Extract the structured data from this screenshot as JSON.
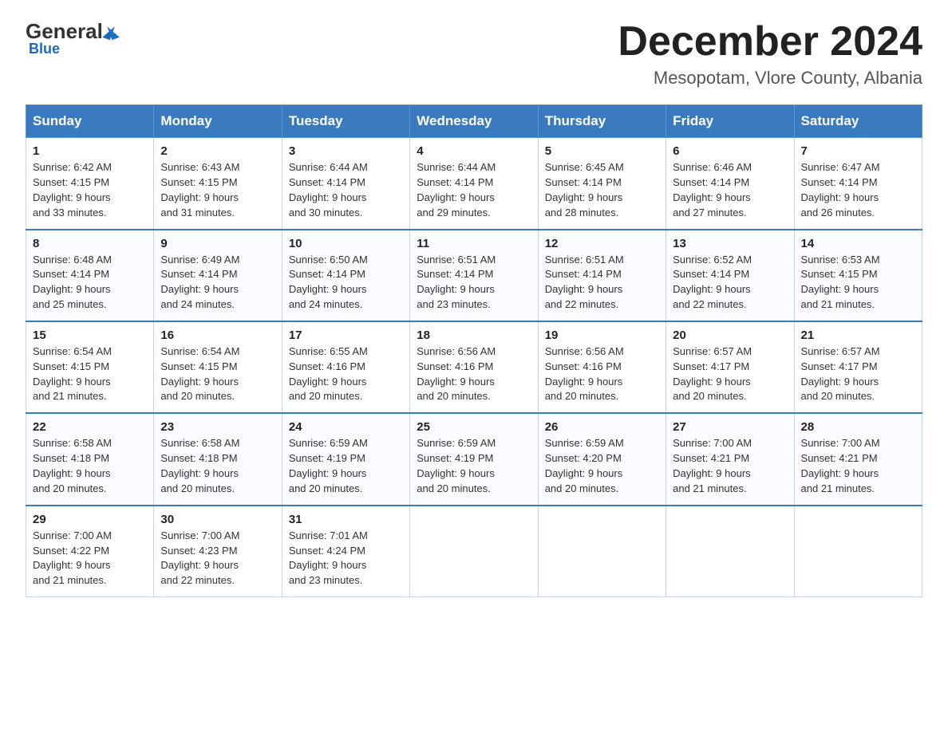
{
  "header": {
    "logo": {
      "general": "General",
      "blue": "Blue"
    },
    "title": "December 2024",
    "location": "Mesopotam, Vlore County, Albania"
  },
  "days_of_week": [
    "Sunday",
    "Monday",
    "Tuesday",
    "Wednesday",
    "Thursday",
    "Friday",
    "Saturday"
  ],
  "weeks": [
    [
      {
        "day": "1",
        "sunrise": "6:42 AM",
        "sunset": "4:15 PM",
        "daylight": "9 hours and 33 minutes."
      },
      {
        "day": "2",
        "sunrise": "6:43 AM",
        "sunset": "4:15 PM",
        "daylight": "9 hours and 31 minutes."
      },
      {
        "day": "3",
        "sunrise": "6:44 AM",
        "sunset": "4:14 PM",
        "daylight": "9 hours and 30 minutes."
      },
      {
        "day": "4",
        "sunrise": "6:44 AM",
        "sunset": "4:14 PM",
        "daylight": "9 hours and 29 minutes."
      },
      {
        "day": "5",
        "sunrise": "6:45 AM",
        "sunset": "4:14 PM",
        "daylight": "9 hours and 28 minutes."
      },
      {
        "day": "6",
        "sunrise": "6:46 AM",
        "sunset": "4:14 PM",
        "daylight": "9 hours and 27 minutes."
      },
      {
        "day": "7",
        "sunrise": "6:47 AM",
        "sunset": "4:14 PM",
        "daylight": "9 hours and 26 minutes."
      }
    ],
    [
      {
        "day": "8",
        "sunrise": "6:48 AM",
        "sunset": "4:14 PM",
        "daylight": "9 hours and 25 minutes."
      },
      {
        "day": "9",
        "sunrise": "6:49 AM",
        "sunset": "4:14 PM",
        "daylight": "9 hours and 24 minutes."
      },
      {
        "day": "10",
        "sunrise": "6:50 AM",
        "sunset": "4:14 PM",
        "daylight": "9 hours and 24 minutes."
      },
      {
        "day": "11",
        "sunrise": "6:51 AM",
        "sunset": "4:14 PM",
        "daylight": "9 hours and 23 minutes."
      },
      {
        "day": "12",
        "sunrise": "6:51 AM",
        "sunset": "4:14 PM",
        "daylight": "9 hours and 22 minutes."
      },
      {
        "day": "13",
        "sunrise": "6:52 AM",
        "sunset": "4:14 PM",
        "daylight": "9 hours and 22 minutes."
      },
      {
        "day": "14",
        "sunrise": "6:53 AM",
        "sunset": "4:15 PM",
        "daylight": "9 hours and 21 minutes."
      }
    ],
    [
      {
        "day": "15",
        "sunrise": "6:54 AM",
        "sunset": "4:15 PM",
        "daylight": "9 hours and 21 minutes."
      },
      {
        "day": "16",
        "sunrise": "6:54 AM",
        "sunset": "4:15 PM",
        "daylight": "9 hours and 20 minutes."
      },
      {
        "day": "17",
        "sunrise": "6:55 AM",
        "sunset": "4:16 PM",
        "daylight": "9 hours and 20 minutes."
      },
      {
        "day": "18",
        "sunrise": "6:56 AM",
        "sunset": "4:16 PM",
        "daylight": "9 hours and 20 minutes."
      },
      {
        "day": "19",
        "sunrise": "6:56 AM",
        "sunset": "4:16 PM",
        "daylight": "9 hours and 20 minutes."
      },
      {
        "day": "20",
        "sunrise": "6:57 AM",
        "sunset": "4:17 PM",
        "daylight": "9 hours and 20 minutes."
      },
      {
        "day": "21",
        "sunrise": "6:57 AM",
        "sunset": "4:17 PM",
        "daylight": "9 hours and 20 minutes."
      }
    ],
    [
      {
        "day": "22",
        "sunrise": "6:58 AM",
        "sunset": "4:18 PM",
        "daylight": "9 hours and 20 minutes."
      },
      {
        "day": "23",
        "sunrise": "6:58 AM",
        "sunset": "4:18 PM",
        "daylight": "9 hours and 20 minutes."
      },
      {
        "day": "24",
        "sunrise": "6:59 AM",
        "sunset": "4:19 PM",
        "daylight": "9 hours and 20 minutes."
      },
      {
        "day": "25",
        "sunrise": "6:59 AM",
        "sunset": "4:19 PM",
        "daylight": "9 hours and 20 minutes."
      },
      {
        "day": "26",
        "sunrise": "6:59 AM",
        "sunset": "4:20 PM",
        "daylight": "9 hours and 20 minutes."
      },
      {
        "day": "27",
        "sunrise": "7:00 AM",
        "sunset": "4:21 PM",
        "daylight": "9 hours and 21 minutes."
      },
      {
        "day": "28",
        "sunrise": "7:00 AM",
        "sunset": "4:21 PM",
        "daylight": "9 hours and 21 minutes."
      }
    ],
    [
      {
        "day": "29",
        "sunrise": "7:00 AM",
        "sunset": "4:22 PM",
        "daylight": "9 hours and 21 minutes."
      },
      {
        "day": "30",
        "sunrise": "7:00 AM",
        "sunset": "4:23 PM",
        "daylight": "9 hours and 22 minutes."
      },
      {
        "day": "31",
        "sunrise": "7:01 AM",
        "sunset": "4:24 PM",
        "daylight": "9 hours and 23 minutes."
      },
      null,
      null,
      null,
      null
    ]
  ],
  "labels": {
    "sunrise": "Sunrise:",
    "sunset": "Sunset:",
    "daylight": "Daylight:"
  }
}
